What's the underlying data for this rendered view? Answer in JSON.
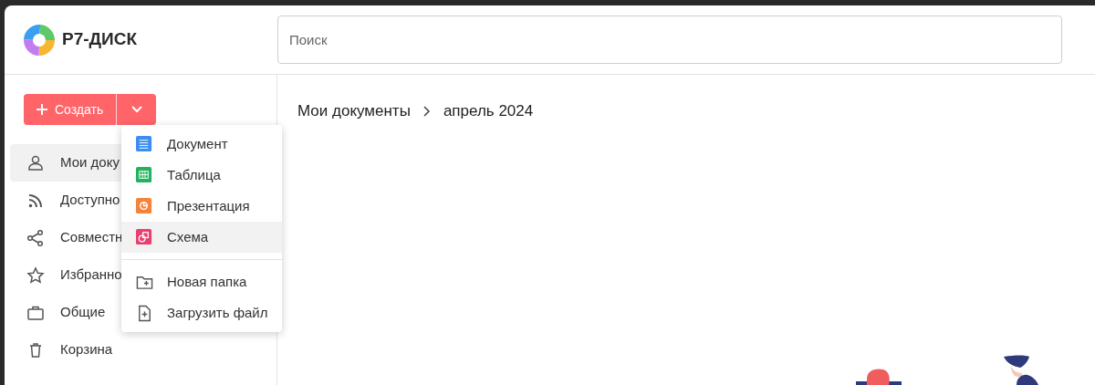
{
  "header": {
    "logo_text": "Р7-ДИСК",
    "search": {
      "placeholder": "Поиск"
    }
  },
  "sidebar": {
    "create_button": "Создать",
    "items": [
      {
        "label": "Мои доку",
        "kind": "person",
        "selected": true
      },
      {
        "label": "Доступно",
        "kind": "rss",
        "selected": false
      },
      {
        "label": "Совместн",
        "kind": "share",
        "selected": false
      },
      {
        "label": "Избранно",
        "kind": "star",
        "selected": false
      },
      {
        "label": "Общие",
        "kind": "briefcase",
        "selected": false
      },
      {
        "label": "Корзина",
        "kind": "trash",
        "selected": false
      }
    ]
  },
  "create_menu": {
    "groups": [
      [
        {
          "label": "Документ",
          "kind": "doc",
          "selected": false
        },
        {
          "label": "Таблица",
          "kind": "table",
          "selected": false
        },
        {
          "label": "Презентация",
          "kind": "pres",
          "selected": false
        },
        {
          "label": "Схема",
          "kind": "scheme",
          "selected": true
        }
      ],
      [
        {
          "label": "Новая папка",
          "kind": "folder",
          "selected": false
        },
        {
          "label": "Загрузить файл",
          "kind": "upload",
          "selected": false
        }
      ]
    ]
  },
  "breadcrumbs": [
    "Мои документы",
    "апрель 2024"
  ]
}
